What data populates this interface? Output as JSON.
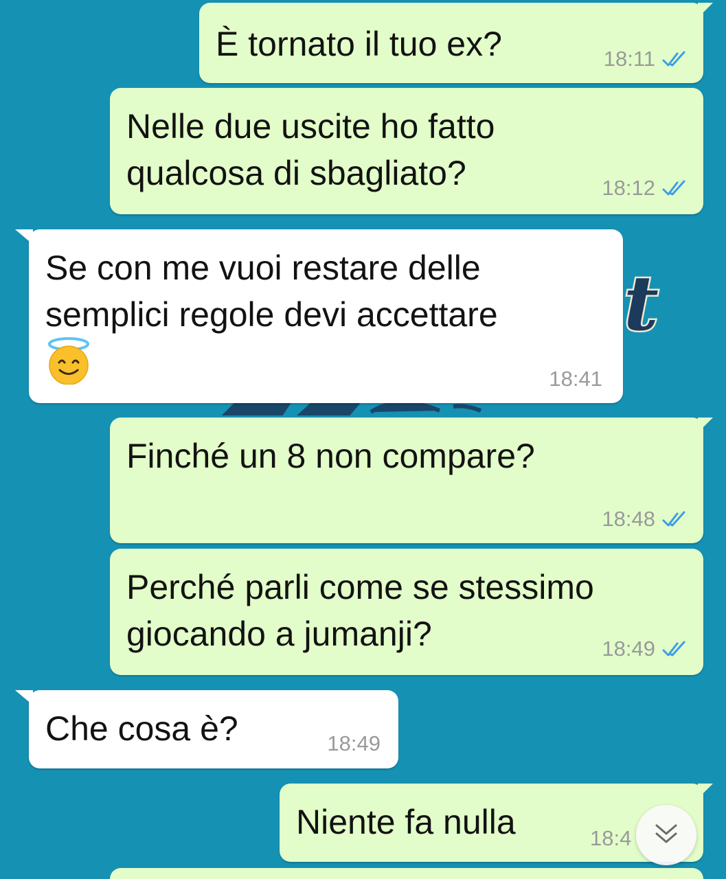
{
  "colors": {
    "wallpaper": "#1591b4",
    "outgoing_bubble": "#e2fdc9",
    "incoming_bubble": "#ffffff",
    "read_ticks": "#3b9ee8",
    "timestamp": "#9a9a9a"
  },
  "messages": [
    {
      "direction": "outgoing",
      "text": "È tornato il tuo ex?",
      "time": "18:11",
      "status": "read"
    },
    {
      "direction": "outgoing",
      "text": "Nelle due uscite ho fatto\nqualcosa di sbagliato?",
      "time": "18:12",
      "status": "read"
    },
    {
      "direction": "incoming",
      "text": "Se con me vuoi restare delle\nsemplici regole devi accettare",
      "emoji": "smiling-face-with-halo",
      "time": "18:41"
    },
    {
      "direction": "outgoing",
      "text": "Finché un 8 non compare?",
      "time": "18:48",
      "status": "read"
    },
    {
      "direction": "outgoing",
      "text": "Perché parli come se stessimo\ngiocando a jumanji?",
      "time": "18:49",
      "status": "read"
    },
    {
      "direction": "incoming",
      "text": "Che cosa è?",
      "time": "18:49"
    },
    {
      "direction": "outgoing",
      "text": "Niente fa nulla",
      "time": "18:4",
      "status": "read"
    }
  ],
  "scroll_to_bottom": {
    "icon": "double-chevron-down-icon"
  }
}
